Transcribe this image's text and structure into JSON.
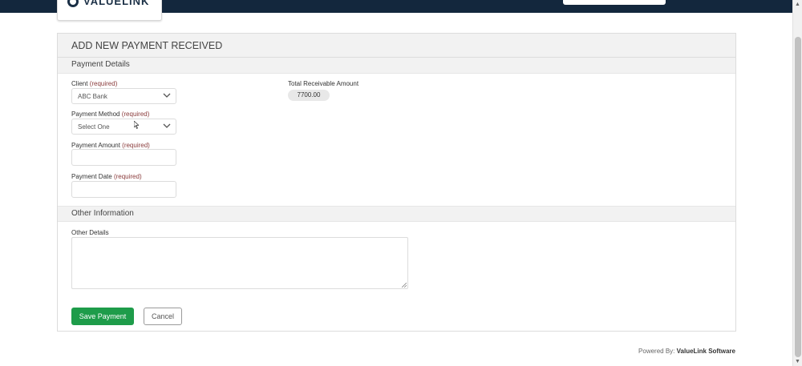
{
  "header": {
    "logo_text": "VALUELINK"
  },
  "page": {
    "title": "ADD NEW PAYMENT RECEIVED"
  },
  "sections": {
    "payment_details": "Payment Details",
    "other_information": "Other Information"
  },
  "form": {
    "required_note": "(required)",
    "client": {
      "label": "Client",
      "value": "ABC Bank"
    },
    "payment_method": {
      "label": "Payment Method",
      "value": "Select One"
    },
    "payment_amount": {
      "label": "Payment Amount",
      "value": ""
    },
    "payment_date": {
      "label": "Payment Date",
      "value": ""
    },
    "total_receivable": {
      "label": "Total Receivable Amount",
      "value": "7700.00"
    },
    "other_details": {
      "label": "Other Details",
      "value": ""
    }
  },
  "buttons": {
    "save": "Save Payment",
    "cancel": "Cancel"
  },
  "footer": {
    "prefix": "Powered By:",
    "brand": "ValueLink Software"
  }
}
